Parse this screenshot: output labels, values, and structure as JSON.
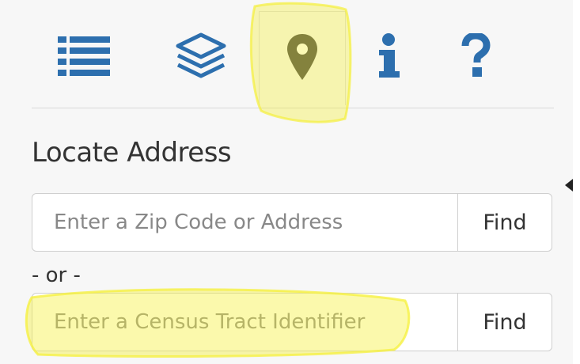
{
  "colors": {
    "icon_blue": "#2d6fae",
    "active_icon": "#3f3f3f",
    "highlight": "#f5f03a"
  },
  "tabs": [
    {
      "icon": "list-icon",
      "active": false
    },
    {
      "icon": "layers-icon",
      "active": false
    },
    {
      "icon": "map-marker-icon",
      "active": true
    },
    {
      "icon": "info-icon",
      "active": false
    },
    {
      "icon": "help-icon",
      "active": false
    }
  ],
  "locate": {
    "title": "Locate Address",
    "address_placeholder": "Enter a Zip Code or Address",
    "address_button": "Find",
    "separator": "- or -",
    "tract_placeholder": "Enter a Census Tract Identifier",
    "tract_button": "Find"
  }
}
